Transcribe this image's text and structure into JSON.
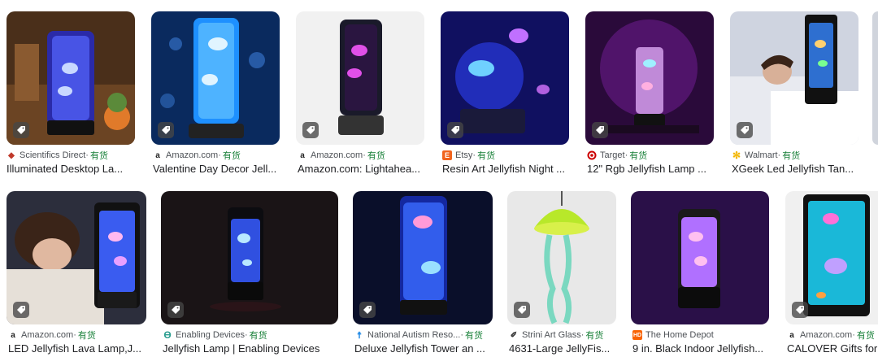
{
  "row1": [
    {
      "source": "Scientifics Direct",
      "sep": " · ",
      "stock": "有货",
      "title": "Illuminated Desktop La...",
      "favicon": "scientifics-icon",
      "fav_color": "#c0392b"
    },
    {
      "source": "Amazon.com",
      "sep": " · ",
      "stock": "有货",
      "title": "Valentine Day Decor Jell...",
      "favicon": "amazon-icon",
      "fav_color": "#222222"
    },
    {
      "source": "Amazon.com",
      "sep": " · ",
      "stock": "有货",
      "title": "Amazon.com: Lightahea...",
      "favicon": "amazon-icon",
      "fav_color": "#222222"
    },
    {
      "source": "Etsy",
      "sep": " · ",
      "stock": "有货",
      "title": "Resin Art Jellyfish Night ...",
      "favicon": "etsy-icon",
      "fav_color": "#f1641e"
    },
    {
      "source": "Target",
      "sep": " · ",
      "stock": "有货",
      "title": "12\" Rgb Jellyfish Lamp ...",
      "favicon": "target-icon",
      "fav_color": "#cc0000"
    },
    {
      "source": "Walmart",
      "sep": " · ",
      "stock": "有货",
      "title": "XGeek Led Jellyfish Tan...",
      "favicon": "walmart-icon",
      "fav_color": "#f2b600"
    }
  ],
  "row2": [
    {
      "source": "Amazon.com",
      "sep": " · ",
      "stock": "有货",
      "title": "LED Jellyfish Lava Lamp,J...",
      "favicon": "amazon-icon",
      "fav_color": "#222222"
    },
    {
      "source": "Enabling Devices",
      "sep": " · ",
      "stock": "有货",
      "title": "Jellyfish Lamp | Enabling Devices",
      "favicon": "enabling-devices-icon",
      "fav_color": "#2a9d8f"
    },
    {
      "source": "National Autism Reso...",
      "sep": " · ",
      "stock": "有货",
      "title": "Deluxe Jellyfish Tower an ...",
      "favicon": "autism-resources-icon",
      "fav_color": "#1e88e5"
    },
    {
      "source": "Strini Art Glass",
      "sep": " · ",
      "stock": "有货",
      "title": "4631-Large JellyFis...",
      "favicon": "strini-icon",
      "fav_color": "#333333"
    },
    {
      "source": "The Home Depot",
      "sep": "",
      "stock": "",
      "title": "9 in. Black Indoor Jellyfish...",
      "favicon": "home-depot-icon",
      "fav_color": "#f96302"
    },
    {
      "source": "Amazon.com",
      "sep": " · ",
      "stock": "有货",
      "title": "CALOVER Gifts for",
      "favicon": "amazon-icon",
      "fav_color": "#222222"
    }
  ]
}
